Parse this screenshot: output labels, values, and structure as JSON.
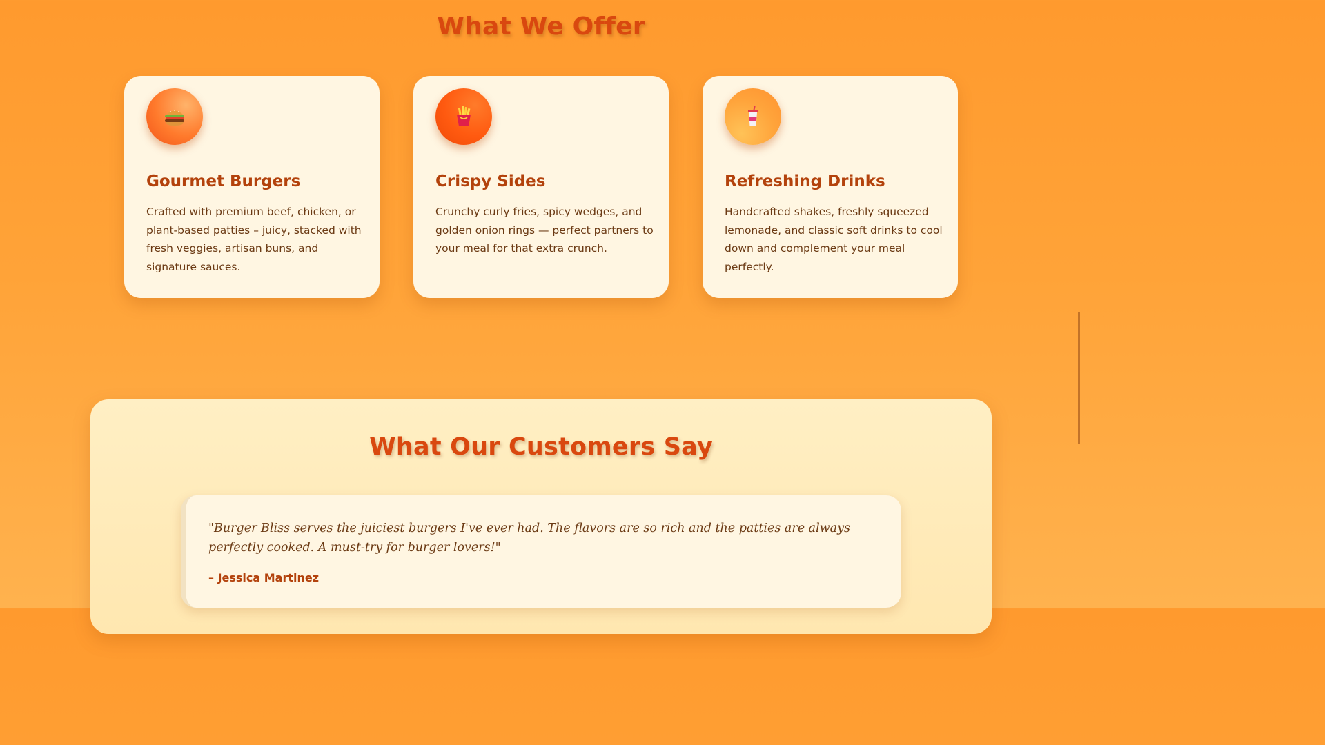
{
  "offer": {
    "title": "What We Offer",
    "cards": [
      {
        "icon": "burger-icon",
        "title": "Gourmet Burgers",
        "description": "Crafted with premium beef, chicken, or plant-based patties – juicy, stacked with fresh veggies, artisan buns, and signature sauces."
      },
      {
        "icon": "fries-icon",
        "title": "Crispy Sides",
        "description": "Crunchy curly fries, spicy wedges, and golden onion rings — perfect partners to your meal for that extra crunch."
      },
      {
        "icon": "drink-icon",
        "title": "Refreshing Drinks",
        "description": "Handcrafted shakes, freshly squeezed lemonade, and classic soft drinks to cool down and complement your meal perfectly."
      }
    ]
  },
  "testimonials": {
    "title": "What Our Customers Say",
    "items": [
      {
        "quote": "\"Burger Bliss serves the juiciest burgers I've ever had. The flavors are so rich and the patties are always perfectly cooked. A must-try for burger lovers!\"",
        "author": "– Jessica Martinez"
      }
    ]
  },
  "colors": {
    "accent": "#d9480f",
    "heading": "#b3420c",
    "card_bg": "#fff6e2",
    "page_bg": "#ffa338"
  }
}
